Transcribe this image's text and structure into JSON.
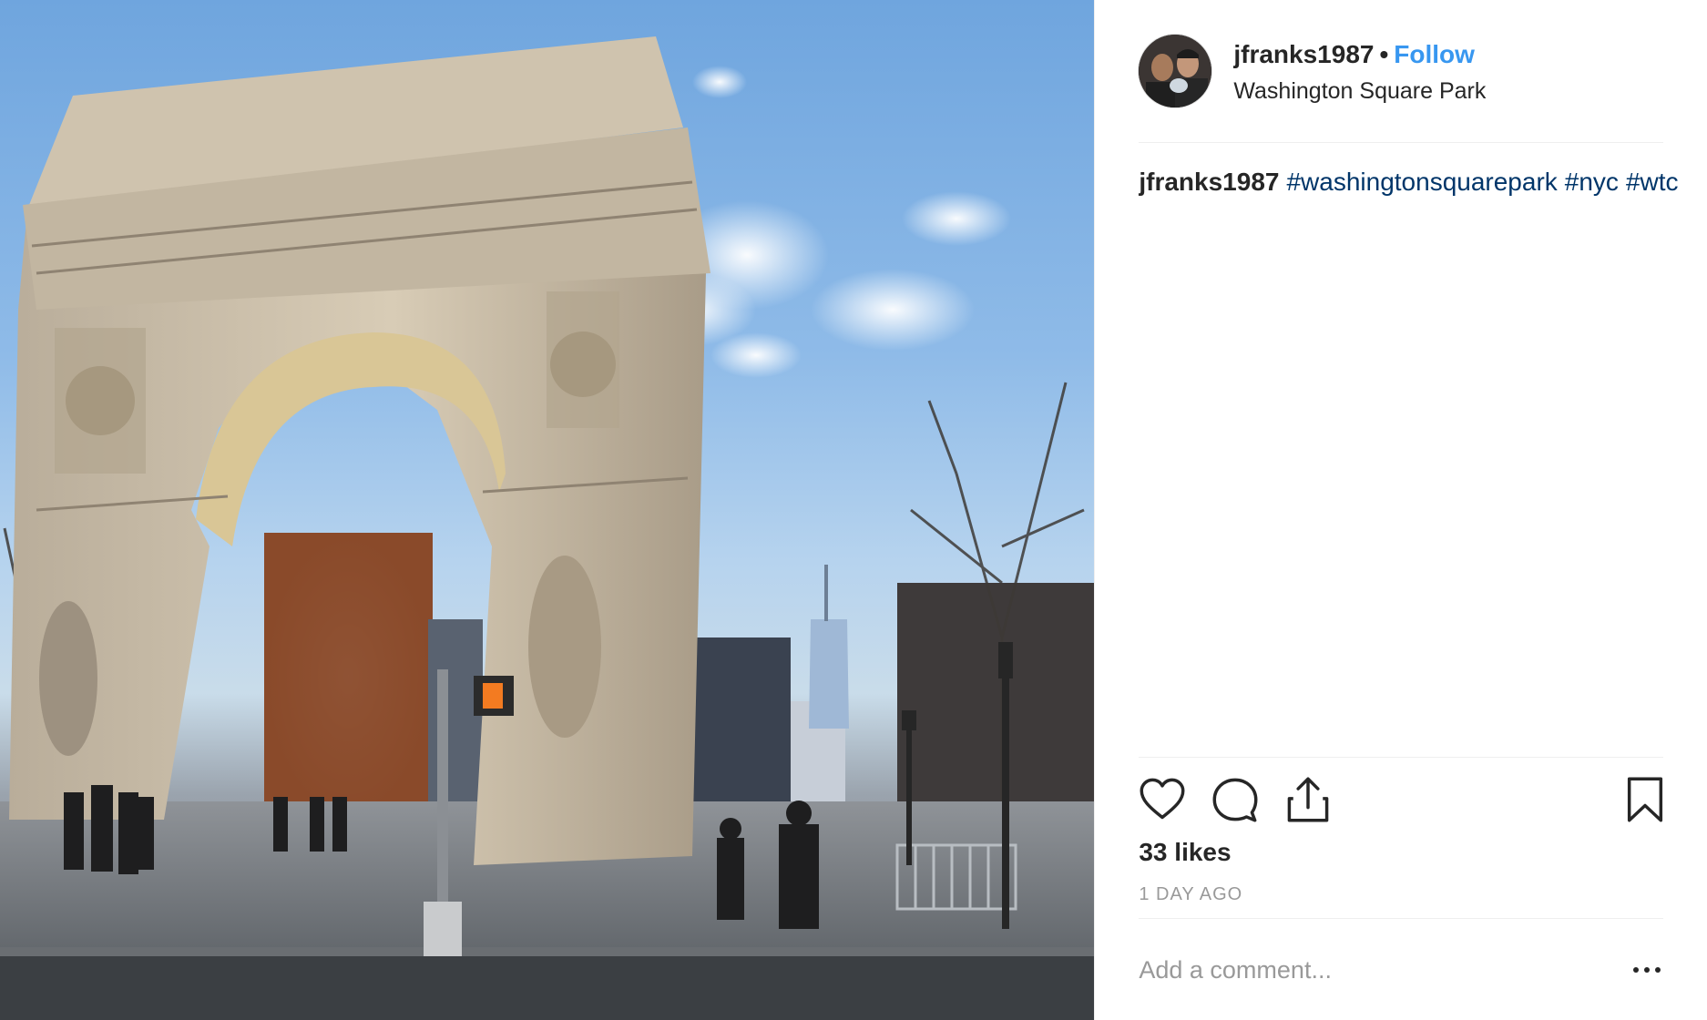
{
  "post": {
    "username": "jfranks1987",
    "separator": "•",
    "follow_label": "Follow",
    "location": "Washington Square Park",
    "caption": {
      "username": "jfranks1987",
      "hashtags": [
        "#washingtonsquarepark",
        "#nyc",
        "#wtc"
      ]
    },
    "likes": "33 likes",
    "time_ago": "1 DAY AGO",
    "comment_placeholder": "Add a comment..."
  },
  "icons": {
    "like": "heart-icon",
    "comment": "comment-bubble-icon",
    "share": "share-icon",
    "save": "bookmark-icon",
    "more": "more-options-icon"
  },
  "colors": {
    "follow": "#3897f0",
    "hashtag": "#003569",
    "text": "#262626",
    "muted": "#999999",
    "divider": "#efefef"
  }
}
